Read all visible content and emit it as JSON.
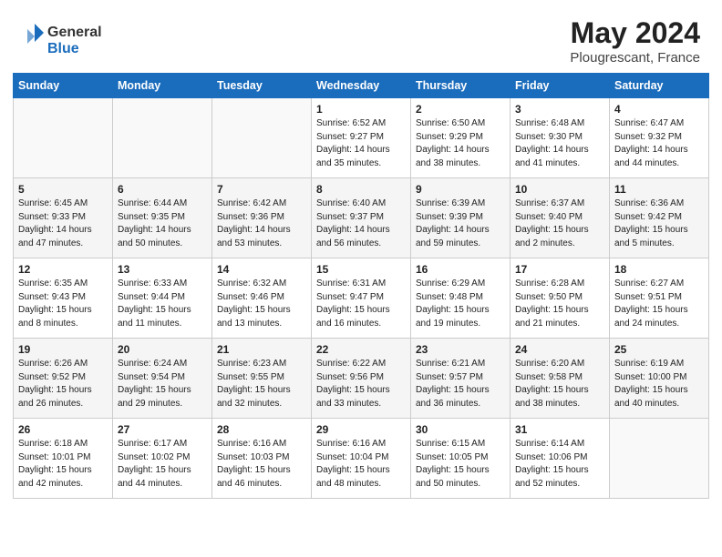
{
  "logo": {
    "line1": "General",
    "line2": "Blue"
  },
  "title": "May 2024",
  "location": "Plougrescant, France",
  "days_header": [
    "Sunday",
    "Monday",
    "Tuesday",
    "Wednesday",
    "Thursday",
    "Friday",
    "Saturday"
  ],
  "weeks": [
    [
      {
        "num": "",
        "sunrise": "",
        "sunset": "",
        "daylight": ""
      },
      {
        "num": "",
        "sunrise": "",
        "sunset": "",
        "daylight": ""
      },
      {
        "num": "",
        "sunrise": "",
        "sunset": "",
        "daylight": ""
      },
      {
        "num": "1",
        "sunrise": "Sunrise: 6:52 AM",
        "sunset": "Sunset: 9:27 PM",
        "daylight": "Daylight: 14 hours and 35 minutes."
      },
      {
        "num": "2",
        "sunrise": "Sunrise: 6:50 AM",
        "sunset": "Sunset: 9:29 PM",
        "daylight": "Daylight: 14 hours and 38 minutes."
      },
      {
        "num": "3",
        "sunrise": "Sunrise: 6:48 AM",
        "sunset": "Sunset: 9:30 PM",
        "daylight": "Daylight: 14 hours and 41 minutes."
      },
      {
        "num": "4",
        "sunrise": "Sunrise: 6:47 AM",
        "sunset": "Sunset: 9:32 PM",
        "daylight": "Daylight: 14 hours and 44 minutes."
      }
    ],
    [
      {
        "num": "5",
        "sunrise": "Sunrise: 6:45 AM",
        "sunset": "Sunset: 9:33 PM",
        "daylight": "Daylight: 14 hours and 47 minutes."
      },
      {
        "num": "6",
        "sunrise": "Sunrise: 6:44 AM",
        "sunset": "Sunset: 9:35 PM",
        "daylight": "Daylight: 14 hours and 50 minutes."
      },
      {
        "num": "7",
        "sunrise": "Sunrise: 6:42 AM",
        "sunset": "Sunset: 9:36 PM",
        "daylight": "Daylight: 14 hours and 53 minutes."
      },
      {
        "num": "8",
        "sunrise": "Sunrise: 6:40 AM",
        "sunset": "Sunset: 9:37 PM",
        "daylight": "Daylight: 14 hours and 56 minutes."
      },
      {
        "num": "9",
        "sunrise": "Sunrise: 6:39 AM",
        "sunset": "Sunset: 9:39 PM",
        "daylight": "Daylight: 14 hours and 59 minutes."
      },
      {
        "num": "10",
        "sunrise": "Sunrise: 6:37 AM",
        "sunset": "Sunset: 9:40 PM",
        "daylight": "Daylight: 15 hours and 2 minutes."
      },
      {
        "num": "11",
        "sunrise": "Sunrise: 6:36 AM",
        "sunset": "Sunset: 9:42 PM",
        "daylight": "Daylight: 15 hours and 5 minutes."
      }
    ],
    [
      {
        "num": "12",
        "sunrise": "Sunrise: 6:35 AM",
        "sunset": "Sunset: 9:43 PM",
        "daylight": "Daylight: 15 hours and 8 minutes."
      },
      {
        "num": "13",
        "sunrise": "Sunrise: 6:33 AM",
        "sunset": "Sunset: 9:44 PM",
        "daylight": "Daylight: 15 hours and 11 minutes."
      },
      {
        "num": "14",
        "sunrise": "Sunrise: 6:32 AM",
        "sunset": "Sunset: 9:46 PM",
        "daylight": "Daylight: 15 hours and 13 minutes."
      },
      {
        "num": "15",
        "sunrise": "Sunrise: 6:31 AM",
        "sunset": "Sunset: 9:47 PM",
        "daylight": "Daylight: 15 hours and 16 minutes."
      },
      {
        "num": "16",
        "sunrise": "Sunrise: 6:29 AM",
        "sunset": "Sunset: 9:48 PM",
        "daylight": "Daylight: 15 hours and 19 minutes."
      },
      {
        "num": "17",
        "sunrise": "Sunrise: 6:28 AM",
        "sunset": "Sunset: 9:50 PM",
        "daylight": "Daylight: 15 hours and 21 minutes."
      },
      {
        "num": "18",
        "sunrise": "Sunrise: 6:27 AM",
        "sunset": "Sunset: 9:51 PM",
        "daylight": "Daylight: 15 hours and 24 minutes."
      }
    ],
    [
      {
        "num": "19",
        "sunrise": "Sunrise: 6:26 AM",
        "sunset": "Sunset: 9:52 PM",
        "daylight": "Daylight: 15 hours and 26 minutes."
      },
      {
        "num": "20",
        "sunrise": "Sunrise: 6:24 AM",
        "sunset": "Sunset: 9:54 PM",
        "daylight": "Daylight: 15 hours and 29 minutes."
      },
      {
        "num": "21",
        "sunrise": "Sunrise: 6:23 AM",
        "sunset": "Sunset: 9:55 PM",
        "daylight": "Daylight: 15 hours and 32 minutes."
      },
      {
        "num": "22",
        "sunrise": "Sunrise: 6:22 AM",
        "sunset": "Sunset: 9:56 PM",
        "daylight": "Daylight: 15 hours and 33 minutes."
      },
      {
        "num": "23",
        "sunrise": "Sunrise: 6:21 AM",
        "sunset": "Sunset: 9:57 PM",
        "daylight": "Daylight: 15 hours and 36 minutes."
      },
      {
        "num": "24",
        "sunrise": "Sunrise: 6:20 AM",
        "sunset": "Sunset: 9:58 PM",
        "daylight": "Daylight: 15 hours and 38 minutes."
      },
      {
        "num": "25",
        "sunrise": "Sunrise: 6:19 AM",
        "sunset": "Sunset: 10:00 PM",
        "daylight": "Daylight: 15 hours and 40 minutes."
      }
    ],
    [
      {
        "num": "26",
        "sunrise": "Sunrise: 6:18 AM",
        "sunset": "Sunset: 10:01 PM",
        "daylight": "Daylight: 15 hours and 42 minutes."
      },
      {
        "num": "27",
        "sunrise": "Sunrise: 6:17 AM",
        "sunset": "Sunset: 10:02 PM",
        "daylight": "Daylight: 15 hours and 44 minutes."
      },
      {
        "num": "28",
        "sunrise": "Sunrise: 6:16 AM",
        "sunset": "Sunset: 10:03 PM",
        "daylight": "Daylight: 15 hours and 46 minutes."
      },
      {
        "num": "29",
        "sunrise": "Sunrise: 6:16 AM",
        "sunset": "Sunset: 10:04 PM",
        "daylight": "Daylight: 15 hours and 48 minutes."
      },
      {
        "num": "30",
        "sunrise": "Sunrise: 6:15 AM",
        "sunset": "Sunset: 10:05 PM",
        "daylight": "Daylight: 15 hours and 50 minutes."
      },
      {
        "num": "31",
        "sunrise": "Sunrise: 6:14 AM",
        "sunset": "Sunset: 10:06 PM",
        "daylight": "Daylight: 15 hours and 52 minutes."
      },
      {
        "num": "",
        "sunrise": "",
        "sunset": "",
        "daylight": ""
      }
    ]
  ]
}
